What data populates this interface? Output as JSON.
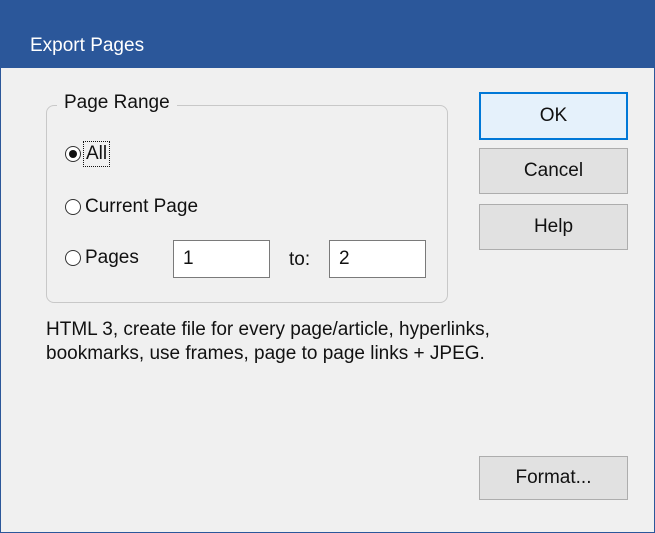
{
  "window": {
    "title": "Export Pages"
  },
  "page_range": {
    "group_label": "Page Range",
    "options": {
      "all": {
        "label": "All",
        "selected": true
      },
      "current": {
        "label": "Current Page",
        "selected": false
      },
      "pages": {
        "label": "Pages",
        "selected": false
      }
    },
    "from_value": "1",
    "to_label": "to:",
    "to_value": "2"
  },
  "buttons": {
    "ok": "OK",
    "cancel": "Cancel",
    "help": "Help",
    "format": "Format..."
  },
  "description": {
    "line1": "HTML 3, create file for every page/article, hyperlinks,",
    "line2": "bookmarks, use frames, page to page links + JPEG."
  },
  "colors": {
    "titlebar": "#2b579a",
    "dialog_background": "#f0f0f0",
    "default_button_border": "#0078d7"
  }
}
